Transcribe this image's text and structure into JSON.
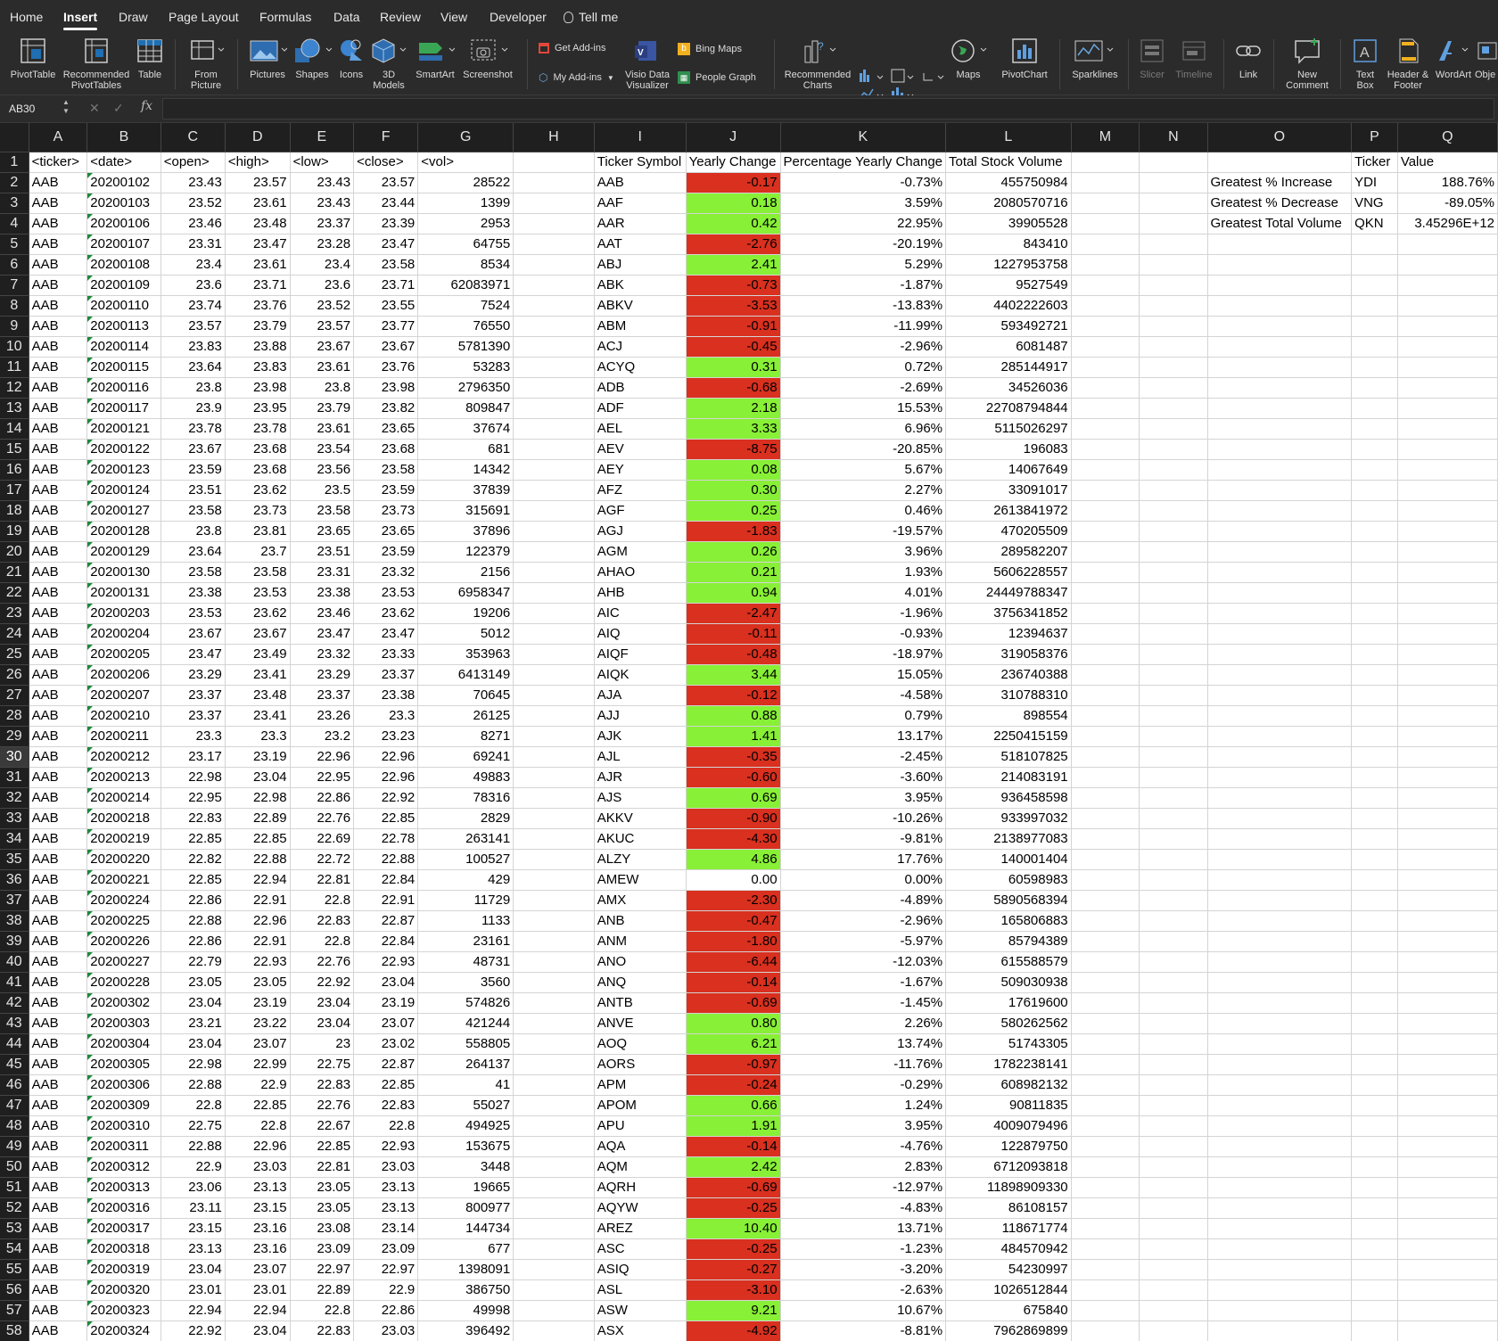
{
  "ribbon_tabs": [
    "Home",
    "Insert",
    "Draw",
    "Page Layout",
    "Formulas",
    "Data",
    "Review",
    "View",
    "Developer",
    "Tell me"
  ],
  "active_tab": "Insert",
  "ribbon_buttons": {
    "pivottable": "PivotTable",
    "recommended_pivottables": "Recommended\nPivotTables",
    "table": "Table",
    "from_picture": "From\nPicture",
    "pictures": "Pictures",
    "shapes": "Shapes",
    "icons": "Icons",
    "models_3d": "3D\nModels",
    "smartart": "SmartArt",
    "screenshot": "Screenshot",
    "get_addins": "Get Add-ins",
    "my_addins": "My Add-ins",
    "visio": "Visio Data\nVisualizer",
    "bing_maps": "Bing Maps",
    "people_graph": "People Graph",
    "recommended_charts": "Recommended\nCharts",
    "maps": "Maps",
    "pivotchart": "PivotChart",
    "sparklines": "Sparklines",
    "slicer": "Slicer",
    "timeline": "Timeline",
    "link": "Link",
    "new_comment": "New\nComment",
    "text_box": "Text\nBox",
    "header_footer": "Header &\nFooter",
    "wordart": "WordArt",
    "object": "Obje"
  },
  "formula_bar": {
    "name_box": "AB30",
    "formula": ""
  },
  "selected_row": 30,
  "colors": {
    "positive": "#88f036",
    "negative": "#d9301f",
    "header_bg": "#1f1f1f",
    "ribbon_bg": "#2b2b2b"
  },
  "columns": [
    "A",
    "B",
    "C",
    "D",
    "E",
    "F",
    "G",
    "H",
    "I",
    "J",
    "K",
    "L",
    "M",
    "N",
    "O",
    "P",
    "Q"
  ],
  "header_row": [
    "<ticker>",
    "<date>",
    "<open>",
    "<high>",
    "<low>",
    "<close>",
    "<vol>",
    "",
    "Ticker Symbol",
    "Yearly Change",
    "Percentage Yearly Change",
    "Total Stock Volume",
    "",
    "",
    "",
    "Ticker",
    "Value"
  ],
  "data_rows": [
    [
      "AAB",
      "20200102",
      "23.43",
      "23.57",
      "23.43",
      "23.57",
      "28522",
      "AAB",
      "-0.17",
      "-0.73%",
      "455750984"
    ],
    [
      "AAB",
      "20200103",
      "23.52",
      "23.61",
      "23.43",
      "23.44",
      "1399",
      "AAF",
      "0.18",
      "3.59%",
      "2080570716"
    ],
    [
      "AAB",
      "20200106",
      "23.46",
      "23.48",
      "23.37",
      "23.39",
      "2953",
      "AAR",
      "0.42",
      "22.95%",
      "39905528"
    ],
    [
      "AAB",
      "20200107",
      "23.31",
      "23.47",
      "23.28",
      "23.47",
      "64755",
      "AAT",
      "-2.76",
      "-20.19%",
      "843410"
    ],
    [
      "AAB",
      "20200108",
      "23.4",
      "23.61",
      "23.4",
      "23.58",
      "8534",
      "ABJ",
      "2.41",
      "5.29%",
      "1227953758"
    ],
    [
      "AAB",
      "20200109",
      "23.6",
      "23.71",
      "23.6",
      "23.71",
      "62083971",
      "ABK",
      "-0.73",
      "-1.87%",
      "9527549"
    ],
    [
      "AAB",
      "20200110",
      "23.74",
      "23.76",
      "23.52",
      "23.55",
      "7524",
      "ABKV",
      "-3.53",
      "-13.83%",
      "4402222603"
    ],
    [
      "AAB",
      "20200113",
      "23.57",
      "23.79",
      "23.57",
      "23.77",
      "76550",
      "ABM",
      "-0.91",
      "-11.99%",
      "593492721"
    ],
    [
      "AAB",
      "20200114",
      "23.83",
      "23.88",
      "23.67",
      "23.67",
      "5781390",
      "ACJ",
      "-0.45",
      "-2.96%",
      "6081487"
    ],
    [
      "AAB",
      "20200115",
      "23.64",
      "23.83",
      "23.61",
      "23.76",
      "53283",
      "ACYQ",
      "0.31",
      "0.72%",
      "285144917"
    ],
    [
      "AAB",
      "20200116",
      "23.8",
      "23.98",
      "23.8",
      "23.98",
      "2796350",
      "ADB",
      "-0.68",
      "-2.69%",
      "34526036"
    ],
    [
      "AAB",
      "20200117",
      "23.9",
      "23.95",
      "23.79",
      "23.82",
      "809847",
      "ADF",
      "2.18",
      "15.53%",
      "22708794844"
    ],
    [
      "AAB",
      "20200121",
      "23.78",
      "23.78",
      "23.61",
      "23.65",
      "37674",
      "AEL",
      "3.33",
      "6.96%",
      "5115026297"
    ],
    [
      "AAB",
      "20200122",
      "23.67",
      "23.68",
      "23.54",
      "23.68",
      "681",
      "AEV",
      "-8.75",
      "-20.85%",
      "196083"
    ],
    [
      "AAB",
      "20200123",
      "23.59",
      "23.68",
      "23.56",
      "23.58",
      "14342",
      "AEY",
      "0.08",
      "5.67%",
      "14067649"
    ],
    [
      "AAB",
      "20200124",
      "23.51",
      "23.62",
      "23.5",
      "23.59",
      "37839",
      "AFZ",
      "0.30",
      "2.27%",
      "33091017"
    ],
    [
      "AAB",
      "20200127",
      "23.58",
      "23.73",
      "23.58",
      "23.73",
      "315691",
      "AGF",
      "0.25",
      "0.46%",
      "2613841972"
    ],
    [
      "AAB",
      "20200128",
      "23.8",
      "23.81",
      "23.65",
      "23.65",
      "37896",
      "AGJ",
      "-1.83",
      "-19.57%",
      "470205509"
    ],
    [
      "AAB",
      "20200129",
      "23.64",
      "23.7",
      "23.51",
      "23.59",
      "122379",
      "AGM",
      "0.26",
      "3.96%",
      "289582207"
    ],
    [
      "AAB",
      "20200130",
      "23.58",
      "23.58",
      "23.31",
      "23.32",
      "2156",
      "AHAO",
      "0.21",
      "1.93%",
      "5606228557"
    ],
    [
      "AAB",
      "20200131",
      "23.38",
      "23.53",
      "23.38",
      "23.53",
      "6958347",
      "AHB",
      "0.94",
      "4.01%",
      "24449788347"
    ],
    [
      "AAB",
      "20200203",
      "23.53",
      "23.62",
      "23.46",
      "23.62",
      "19206",
      "AIC",
      "-2.47",
      "-1.96%",
      "3756341852"
    ],
    [
      "AAB",
      "20200204",
      "23.67",
      "23.67",
      "23.47",
      "23.47",
      "5012",
      "AIQ",
      "-0.11",
      "-0.93%",
      "12394637"
    ],
    [
      "AAB",
      "20200205",
      "23.47",
      "23.49",
      "23.32",
      "23.33",
      "353963",
      "AIQF",
      "-0.48",
      "-18.97%",
      "319058376"
    ],
    [
      "AAB",
      "20200206",
      "23.29",
      "23.41",
      "23.29",
      "23.37",
      "6413149",
      "AIQK",
      "3.44",
      "15.05%",
      "236740388"
    ],
    [
      "AAB",
      "20200207",
      "23.37",
      "23.48",
      "23.37",
      "23.38",
      "70645",
      "AJA",
      "-0.12",
      "-4.58%",
      "310788310"
    ],
    [
      "AAB",
      "20200210",
      "23.37",
      "23.41",
      "23.26",
      "23.3",
      "26125",
      "AJJ",
      "0.88",
      "0.79%",
      "898554"
    ],
    [
      "AAB",
      "20200211",
      "23.3",
      "23.3",
      "23.2",
      "23.23",
      "8271",
      "AJK",
      "1.41",
      "13.17%",
      "2250415159"
    ],
    [
      "AAB",
      "20200212",
      "23.17",
      "23.19",
      "22.96",
      "22.96",
      "69241",
      "AJL",
      "-0.35",
      "-2.45%",
      "518107825"
    ],
    [
      "AAB",
      "20200213",
      "22.98",
      "23.04",
      "22.95",
      "22.96",
      "49883",
      "AJR",
      "-0.60",
      "-3.60%",
      "214083191"
    ],
    [
      "AAB",
      "20200214",
      "22.95",
      "22.98",
      "22.86",
      "22.92",
      "78316",
      "AJS",
      "0.69",
      "3.95%",
      "936458598"
    ],
    [
      "AAB",
      "20200218",
      "22.83",
      "22.89",
      "22.76",
      "22.85",
      "2829",
      "AKKV",
      "-0.90",
      "-10.26%",
      "933997032"
    ],
    [
      "AAB",
      "20200219",
      "22.85",
      "22.85",
      "22.69",
      "22.78",
      "263141",
      "AKUC",
      "-4.30",
      "-9.81%",
      "2138977083"
    ],
    [
      "AAB",
      "20200220",
      "22.82",
      "22.88",
      "22.72",
      "22.88",
      "100527",
      "ALZY",
      "4.86",
      "17.76%",
      "140001404"
    ],
    [
      "AAB",
      "20200221",
      "22.85",
      "22.94",
      "22.81",
      "22.84",
      "429",
      "AMEW",
      "0.00",
      "0.00%",
      "60598983"
    ],
    [
      "AAB",
      "20200224",
      "22.86",
      "22.91",
      "22.8",
      "22.91",
      "11729",
      "AMX",
      "-2.30",
      "-4.89%",
      "5890568394"
    ],
    [
      "AAB",
      "20200225",
      "22.88",
      "22.96",
      "22.83",
      "22.87",
      "1133",
      "ANB",
      "-0.47",
      "-2.96%",
      "165806883"
    ],
    [
      "AAB",
      "20200226",
      "22.86",
      "22.91",
      "22.8",
      "22.84",
      "23161",
      "ANM",
      "-1.80",
      "-5.97%",
      "85794389"
    ],
    [
      "AAB",
      "20200227",
      "22.79",
      "22.93",
      "22.76",
      "22.93",
      "48731",
      "ANO",
      "-6.44",
      "-12.03%",
      "615588579"
    ],
    [
      "AAB",
      "20200228",
      "23.05",
      "23.05",
      "22.92",
      "23.04",
      "3560",
      "ANQ",
      "-0.14",
      "-1.67%",
      "509030938"
    ],
    [
      "AAB",
      "20200302",
      "23.04",
      "23.19",
      "23.04",
      "23.19",
      "574826",
      "ANTB",
      "-0.69",
      "-1.45%",
      "17619600"
    ],
    [
      "AAB",
      "20200303",
      "23.21",
      "23.22",
      "23.04",
      "23.07",
      "421244",
      "ANVE",
      "0.80",
      "2.26%",
      "580262562"
    ],
    [
      "AAB",
      "20200304",
      "23.04",
      "23.07",
      "23",
      "23.02",
      "558805",
      "AOQ",
      "6.21",
      "13.74%",
      "51743305"
    ],
    [
      "AAB",
      "20200305",
      "22.98",
      "22.99",
      "22.75",
      "22.87",
      "264137",
      "AORS",
      "-0.97",
      "-11.76%",
      "1782238141"
    ],
    [
      "AAB",
      "20200306",
      "22.88",
      "22.9",
      "22.83",
      "22.85",
      "41",
      "APM",
      "-0.24",
      "-0.29%",
      "608982132"
    ],
    [
      "AAB",
      "20200309",
      "22.8",
      "22.85",
      "22.76",
      "22.83",
      "55027",
      "APOM",
      "0.66",
      "1.24%",
      "90811835"
    ],
    [
      "AAB",
      "20200310",
      "22.75",
      "22.8",
      "22.67",
      "22.8",
      "494925",
      "APU",
      "1.91",
      "3.95%",
      "4009079496"
    ],
    [
      "AAB",
      "20200311",
      "22.88",
      "22.96",
      "22.85",
      "22.93",
      "153675",
      "AQA",
      "-0.14",
      "-4.76%",
      "122879750"
    ],
    [
      "AAB",
      "20200312",
      "22.9",
      "23.03",
      "22.81",
      "23.03",
      "3448",
      "AQM",
      "2.42",
      "2.83%",
      "6712093818"
    ],
    [
      "AAB",
      "20200313",
      "23.06",
      "23.13",
      "23.05",
      "23.13",
      "19665",
      "AQRH",
      "-0.69",
      "-12.97%",
      "11898909330"
    ],
    [
      "AAB",
      "20200316",
      "23.11",
      "23.15",
      "23.05",
      "23.13",
      "800977",
      "AQYW",
      "-0.25",
      "-4.83%",
      "86108157"
    ],
    [
      "AAB",
      "20200317",
      "23.15",
      "23.16",
      "23.08",
      "23.14",
      "144734",
      "AREZ",
      "10.40",
      "13.71%",
      "118671774"
    ],
    [
      "AAB",
      "20200318",
      "23.13",
      "23.16",
      "23.09",
      "23.09",
      "677",
      "ASC",
      "-0.25",
      "-1.23%",
      "484570942"
    ],
    [
      "AAB",
      "20200319",
      "23.04",
      "23.07",
      "22.97",
      "22.97",
      "1398091",
      "ASIQ",
      "-0.27",
      "-3.20%",
      "54230997"
    ],
    [
      "AAB",
      "20200320",
      "23.01",
      "23.01",
      "22.89",
      "22.9",
      "386750",
      "ASL",
      "-3.10",
      "-2.63%",
      "1026512844"
    ],
    [
      "AAB",
      "20200323",
      "22.94",
      "22.94",
      "22.8",
      "22.86",
      "49998",
      "ASW",
      "9.21",
      "10.67%",
      "675840"
    ],
    [
      "AAB",
      "20200324",
      "22.92",
      "23.04",
      "22.83",
      "23.03",
      "396492",
      "ASX",
      "-4.92",
      "-8.81%",
      "7962869899"
    ]
  ],
  "summary": [
    {
      "label": "Greatest % Increase",
      "ticker": "YDI",
      "value": "188.76%"
    },
    {
      "label": "Greatest % Decrease",
      "ticker": "VNG",
      "value": "-89.05%"
    },
    {
      "label": "Greatest Total Volume",
      "ticker": "QKN",
      "value": "3.45296E+12"
    }
  ]
}
